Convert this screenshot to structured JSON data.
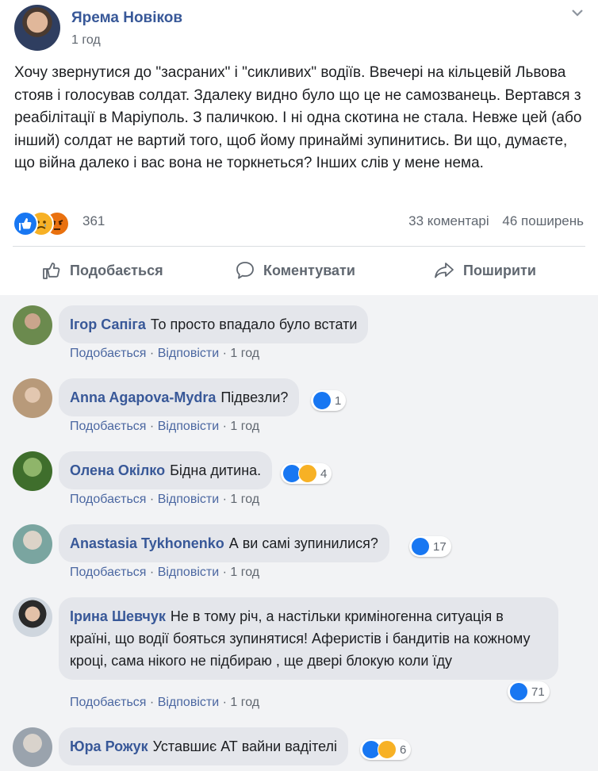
{
  "post": {
    "author": "Ярема Новіков",
    "time": "1 год",
    "text": "Хочу звернутися до \"засраних\" і \"сикливих\" водіїв. Ввечері на кільцевій Львова стояв і голосував солдат. Здалеку видно було що це не самозванець. Вертався з реабілітації в Маріуполь. З паличкою. І ні одна скотина не стала. Невже цей (або інший) солдат не вартий того, щоб йому принаймі зупинитись. Ви що, думаєте, що війна далеко і вас вона не торкнеться? Інших слів у мене нема.",
    "reaction_count": "361",
    "comments_count": "33 коментарі",
    "shares_count": "46 поширень"
  },
  "actions": {
    "like": "Подобається",
    "comment": "Коментувати",
    "share": "Поширити"
  },
  "comment_meta": {
    "like": "Подобається",
    "reply": "Відповісти",
    "sep": " · "
  },
  "comments": [
    {
      "name": "Ігор Сапіга",
      "text": "То просто впадало було встати",
      "time": "1 год",
      "reactions": ""
    },
    {
      "name": "Anna Agapova-Mydra",
      "text": "Підвезли?",
      "time": "1 год",
      "reactions": "1"
    },
    {
      "name": "Олена Окілко",
      "text": "Бідна дитина.",
      "time": "1 год",
      "reactions": "4"
    },
    {
      "name": "Anastasia Tykhonenko",
      "text": "А ви самі зупинилися?",
      "time": "1 год",
      "reactions": "17"
    },
    {
      "name": "Ірина Шевчук",
      "text": "Не в тому річ, а настільки криміногенна ситуація в країні, що водії бояться зупинятися! Аферистів і бандитів на кожному кроці, сама нікого не підбираю , ще двері блокую коли їду",
      "time": "1 год",
      "reactions": "71"
    },
    {
      "name": "Юра Рожук",
      "text": "Уставшиє АТ вайни вадітелі",
      "time": "",
      "reactions": "6"
    }
  ],
  "colors": {
    "link": "#385898",
    "like": "#1877f2",
    "sad": "#f7b125",
    "angry": "#e9710f",
    "bubble": "#e4e6eb"
  }
}
